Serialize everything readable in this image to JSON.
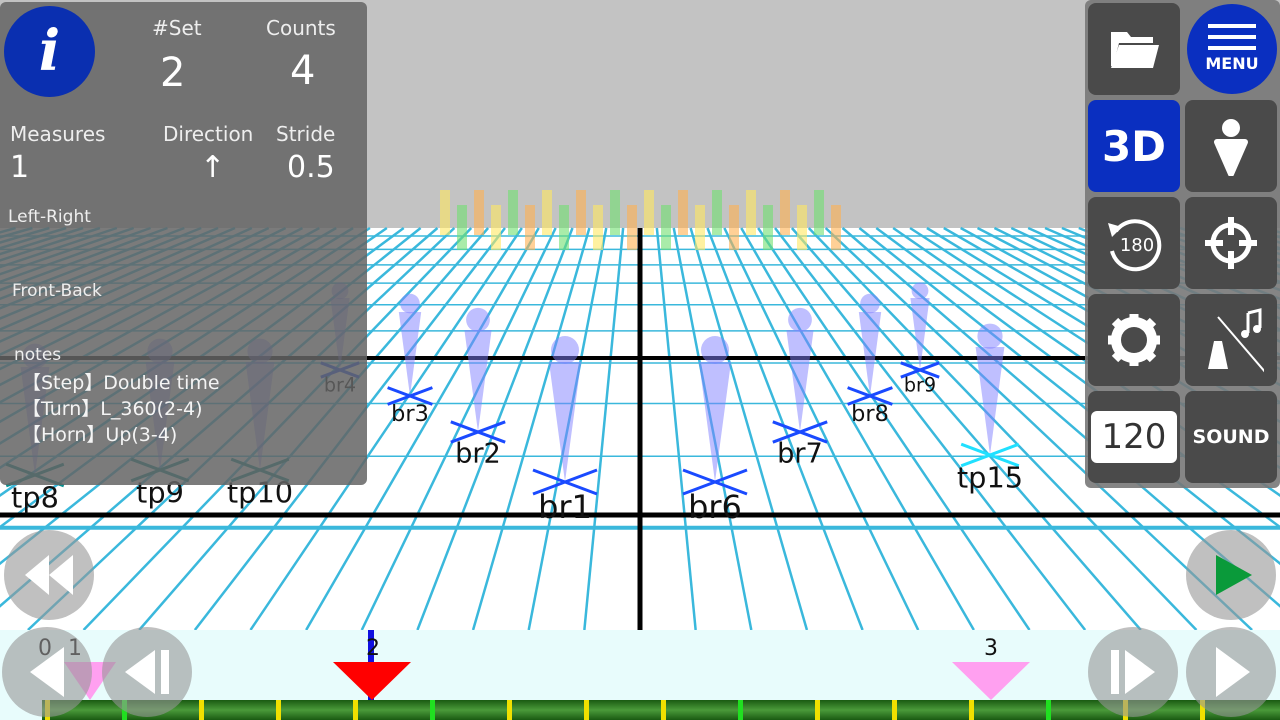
{
  "info": {
    "icon": "info-icon",
    "set_label": "#Set",
    "set_value": "2",
    "counts_label": "Counts",
    "counts_value": "4",
    "measures_label": "Measures",
    "measures_value": "1",
    "direction_label": "Direction",
    "direction_value": "↑",
    "stride_label": "Stride",
    "stride_value": "0.5",
    "left_right_label": "Left-Right",
    "front_back_label": "Front-Back",
    "notes_label": "notes",
    "notes": [
      "【Step】Double time",
      "【Turn】L_360(2-4)",
      "【Horn】Up(3-4)"
    ]
  },
  "toolbar": {
    "open": "folder-open-icon",
    "menu_label": "MENU",
    "view_3d_label": "3D",
    "person": "person-view-icon",
    "rotate_label": "180",
    "target": "crosshair-icon",
    "settings": "gear-icon",
    "metronome": "metronome-off-icon",
    "tempo_value": "120",
    "sound_label": "SOUND",
    "accent_blue": "#0a2fc0"
  },
  "field": {
    "markers": [
      {
        "label": "br1",
        "color": "#1a4aff"
      },
      {
        "label": "br6",
        "color": "#1a4aff"
      },
      {
        "label": "br2",
        "color": "#1a4aff"
      },
      {
        "label": "br7",
        "color": "#1a4aff"
      },
      {
        "label": "br3",
        "color": "#1a4aff"
      },
      {
        "label": "br8",
        "color": "#1a4aff"
      },
      {
        "label": "br9",
        "color": "#1a4aff"
      },
      {
        "label": "br4",
        "color": "#1a4aff"
      },
      {
        "label": "tp15",
        "color": "#20e0ff"
      },
      {
        "label": "tp8",
        "color": "#0a9090"
      },
      {
        "label": "tp9",
        "color": "#0a9090"
      },
      {
        "label": "tp10",
        "color": "#0a9090"
      }
    ],
    "grid_color": "#3ab8dc"
  },
  "timeline": {
    "set_marks": [
      "0",
      "1",
      "2",
      "3"
    ],
    "current_set": "2",
    "current_color": "#ff0000",
    "set_marker_color": "#ffa0f0"
  },
  "playback": {
    "rewind": "rewind-icon",
    "play_forward": "play-green-icon",
    "prev_set": "prev-set-icon",
    "step_back": "step-back-icon",
    "step_forward": "step-forward-icon",
    "play": "play-icon"
  }
}
